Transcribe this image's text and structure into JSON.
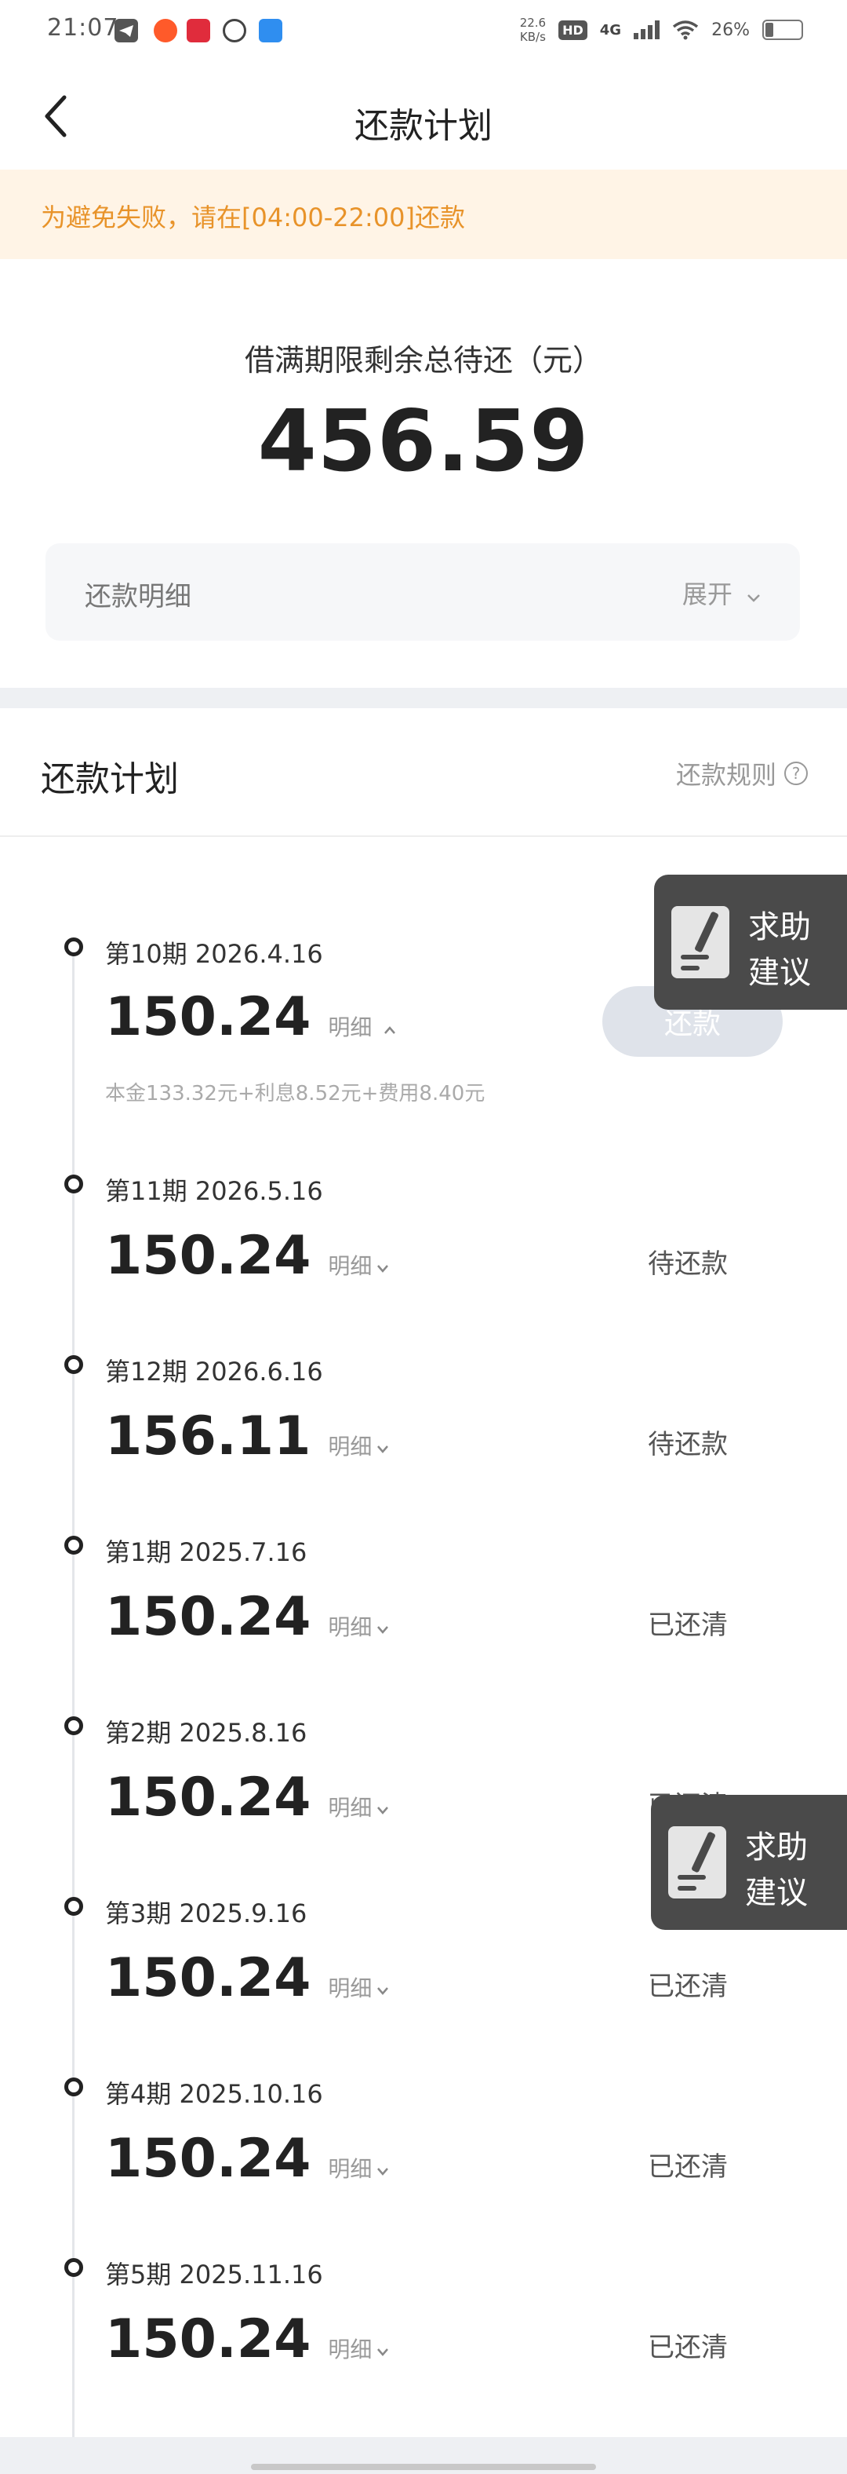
{
  "status_bar": {
    "time": "21:07",
    "net_speed_value": "22.6",
    "net_speed_unit": "KB/s",
    "hd": "HD",
    "network": "4G",
    "battery": "26%"
  },
  "header": {
    "title": "还款计划"
  },
  "notice": {
    "text": "为避免失败，请在[04:00-22:00]还款"
  },
  "summary": {
    "label": "借满期限剩余总待还（元）",
    "amount": "456.59",
    "detail_label": "还款明细",
    "expand_label": "展开"
  },
  "plan": {
    "title": "还款计划",
    "rules_label": "还款规则",
    "installments": [
      {
        "title": "第10期 2026.4.16",
        "amount": "150.24",
        "detail": "明细",
        "status": "",
        "button": "还款",
        "breakdown": "本金133.32元+利息8.52元+费用8.40元"
      },
      {
        "title": "第11期 2026.5.16",
        "amount": "150.24",
        "detail": "明细",
        "status": "待还款"
      },
      {
        "title": "第12期 2026.6.16",
        "amount": "156.11",
        "detail": "明细",
        "status": "待还款"
      },
      {
        "title": "第1期 2025.7.16",
        "amount": "150.24",
        "detail": "明细",
        "status": "已还清"
      },
      {
        "title": "第2期 2025.8.16",
        "amount": "150.24",
        "detail": "明细",
        "status": "已还清"
      },
      {
        "title": "第3期 2025.9.16",
        "amount": "150.24",
        "detail": "明细",
        "status": "已还清"
      },
      {
        "title": "第4期 2025.10.16",
        "amount": "150.24",
        "detail": "明细",
        "status": "已还清"
      },
      {
        "title": "第5期 2025.11.16",
        "amount": "150.24",
        "detail": "明细",
        "status": "已还清"
      }
    ]
  },
  "help": {
    "line1": "求助",
    "line2": "建议"
  },
  "colors": {
    "notice_text": "#e8932a",
    "notice_bg": "#fff4e6",
    "pay_button": "#dfe3ea"
  }
}
